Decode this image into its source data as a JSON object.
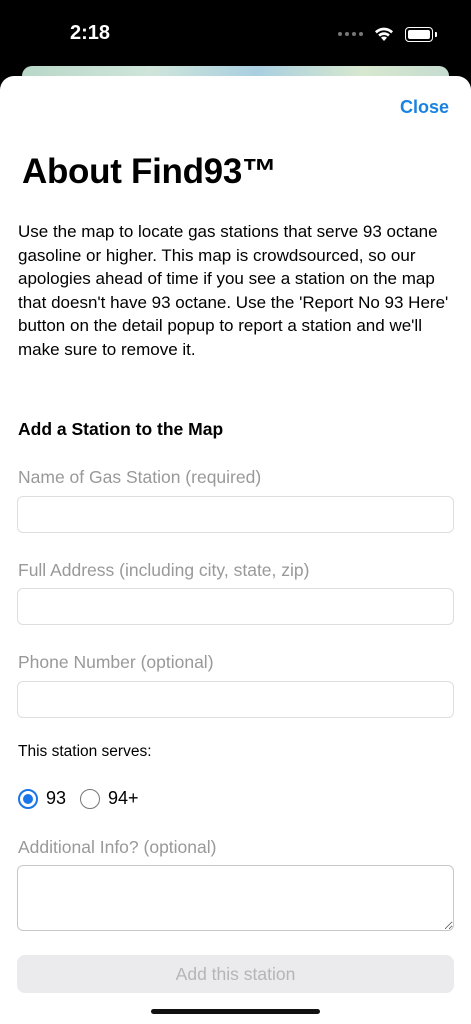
{
  "status_bar": {
    "time": "2:18"
  },
  "sheet": {
    "close_label": "Close",
    "title": "About Find93™",
    "description": "Use the map to locate gas stations that serve 93 octane gasoline or higher. This map is crowdsourced, so our apologies ahead of time if you see a station on the map that doesn't have 93 octane. Use the 'Report No 93 Here' button on the detail popup to report a station and we'll make sure to remove it."
  },
  "form": {
    "heading": "Add a Station to the Map",
    "name_label": "Name of Gas Station (required)",
    "name_value": "",
    "address_label": "Full Address (including city, state, zip)",
    "address_value": "",
    "phone_label": "Phone Number (optional)",
    "phone_value": "",
    "serves_label": "This station serves:",
    "octane_options": [
      {
        "label": "93",
        "selected": true
      },
      {
        "label": "94+",
        "selected": false
      }
    ],
    "additional_label": "Additional Info? (optional)",
    "additional_value": "",
    "submit_label": "Add this station"
  },
  "colors": {
    "accent": "#1a82e0",
    "radio_selected": "#1a76e8",
    "label_gray": "#999999",
    "button_disabled_bg": "#ebebed",
    "button_disabled_text": "#b5b5b8"
  },
  "icons": [
    "cellular-signal-icon",
    "wifi-icon",
    "battery-icon"
  ]
}
